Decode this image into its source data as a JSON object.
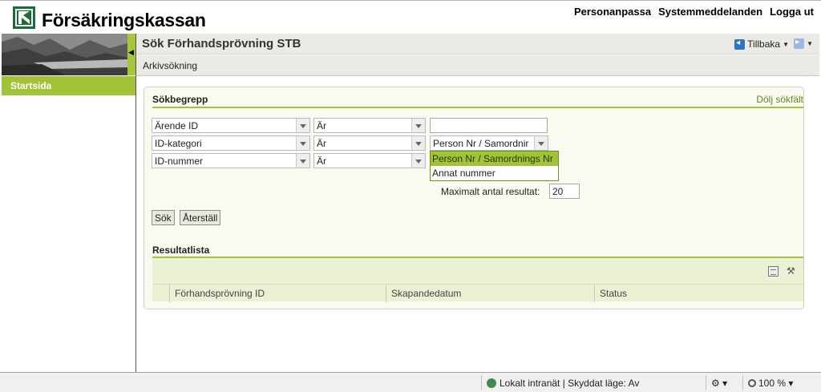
{
  "header": {
    "brand": "Försäkringskassan",
    "links": [
      "Personanpassa",
      "Systemmeddelanden",
      "Logga ut"
    ]
  },
  "sidebar": {
    "items": [
      {
        "label": "Startsida"
      }
    ]
  },
  "titlebar": {
    "title": "Sök Förhandsprövning STB",
    "back_label": "Tillbaka"
  },
  "breadcrumb": "Arkivsökning",
  "search": {
    "heading": "Sökbegrepp",
    "toggle_link": "Dölj sökfält",
    "rows": [
      {
        "field": "Ärende ID",
        "operator": "Är",
        "value": ""
      },
      {
        "field": "ID-kategori",
        "operator": "Är",
        "value": "Person Nr / Samordnir"
      },
      {
        "field": "ID-nummer",
        "operator": "Är",
        "value": ""
      }
    ],
    "dropdown_options": [
      "Person Nr / Samordnings Nr",
      "Annat nummer"
    ],
    "max_label": "Maximalt antal resultat:",
    "max_value": "20",
    "search_button": "Sök",
    "reset_button": "Återställ"
  },
  "results": {
    "heading": "Resultatlista",
    "columns": [
      "Förhandsprövning ID",
      "Skapandedatum",
      "Status"
    ]
  },
  "statusbar": {
    "zone": "Lokalt intranät | Skyddat läge: Av",
    "zoom": "100 %"
  },
  "colors": {
    "accent_green": "#a2c338",
    "brand_green": "#1d6a3a"
  }
}
